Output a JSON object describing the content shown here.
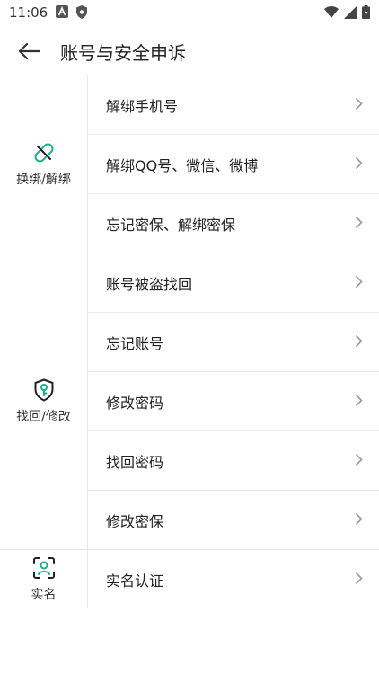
{
  "status_bar": {
    "time": "11:06"
  },
  "app_bar": {
    "title": "账号与安全申诉"
  },
  "sections": [
    {
      "category": "换绑/解绑",
      "icon": "unlink-icon",
      "items": [
        "解绑手机号",
        "解绑QQ号、微信、微博",
        "忘记密保、解绑密保"
      ]
    },
    {
      "category": "找回/修改",
      "icon": "shield-key-icon",
      "items": [
        "账号被盗找回",
        "忘记账号",
        "修改密码",
        "找回密码",
        "修改密保"
      ]
    },
    {
      "category": "实名",
      "icon": "face-id-icon",
      "items": [
        "实名认证"
      ]
    }
  ],
  "colors": {
    "accent": "#1bb385",
    "text": "#222222",
    "divider": "#e8e8e8",
    "chevron": "#9a9a9a"
  }
}
